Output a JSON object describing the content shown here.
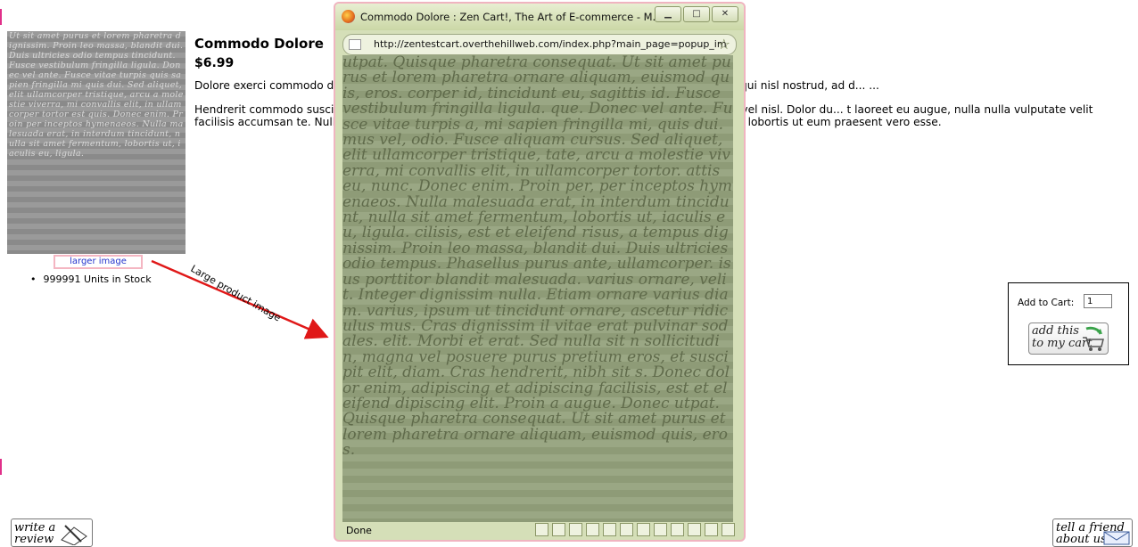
{
  "product": {
    "title": "Commodo Dolore",
    "price": "$6.99",
    "larger_image_link": "larger image",
    "stock": "999991 Units in Stock",
    "description": [
      "Dolore exerci commodo d... luptatum at blandit in lobortis vel feugiat. Ullamcorper in in, in duis sed qui nisl nostrud, ad d... ...",
      "Hendrerit commodo susci... sto laoreet, facilisi lobortis, autem ut nostrud minim te, aliquip euismod vel nisl. Dolor du... t laoreet eu augue, nulla nulla vulputate velit facilisis accumsan te. Nulla nulla, luptatum, qui... nsequat vulputate in, enim at autem nulla ad iriure lobortis ut eum praesent vero esse."
    ],
    "image_text": "Ut sit amet purus et lorem pharetra dignissim. Proin leo massa, blandit dui. Duis ultricies odio tempus tincidunt. Fusce vestibulum fringilla ligula. Donec vel ante. Fusce vitae turpis quis sapien fringilla mi quis dui. Sed aliquet, elit ullamcorper tristique, arcu a molestie viverra, mi convallis elit, in ullamcorper tortor est quis. Donec enim. Proin per inceptos hymenaeos. Nulla malesuada erat, in interdum tincidunt, nulla sit amet fermentum, lobortis ut, iaculis eu, ligula."
  },
  "annotation": "Large product image",
  "cart": {
    "label": "Add to Cart:",
    "quantity": "1",
    "button_line1": "add this",
    "button_line2": "to my cart"
  },
  "buttons": {
    "review_line1": "write a",
    "review_line2": "review",
    "friend_line1": "tell a friend",
    "friend_line2": "about us"
  },
  "popup": {
    "title": "Commodo Dolore : Zen Cart!, The Art of E-commerce - M...",
    "url": "http://zentestcart.overthehillweb.com/index.php?main_page=popup_im",
    "status": "Done",
    "image_text": "utpat. Quisque pharetra consequat. Ut sit amet purus et lorem pharetra ornare aliquam, euismod quis, eros. corper id, tincidunt eu, sagittis id. Fusce vestibulum fringilla ligula. que. Donec vel ante. Fusce vitae turpis a, mi sapien fringilla mi, quis dui. mus vel, odio. Fusce aliquam cursus. Sed aliquet, elit ullamcorper tristique, tate, arcu a molestie viverra, mi convallis elit, in ullamcorper tortor. attis eu, nunc. Donec enim. Proin per, per inceptos hymenaeos. Nulla malesuada erat, in interdum tincidunt, nulla sit amet fermentum, lobortis ut, iaculis eu, ligula. cilisis, est et eleifend risus, a tempus dignissim. Proin leo massa, blandit dui. Duis ultricies odio tempus. Phasellus purus ante, ullamcorper. isus porttitor blandit malesuada. varius ornare, velit. Integer dignissim nulla. Etiam ornare varius diam. varius, ipsum ut tincidunt ornare, ascetur ridiculus mus. Cras dignissim il vitae erat pulvinar sodales. elit. Morbi et erat. Sed nulla sit n sollicitudin, magna vel posuere purus pretium eros, et suscipit elit, diam. Cras hendrerit, nibh sit s. Donec dolor enim, adipiscing et adipiscing facilisis, est et eleifend dipiscing elit. Proin a augue. Donec utpat. Quisque pharetra consequat. Ut sit amet purus et lorem pharetra ornare aliquam, euismod quis, eros."
  }
}
